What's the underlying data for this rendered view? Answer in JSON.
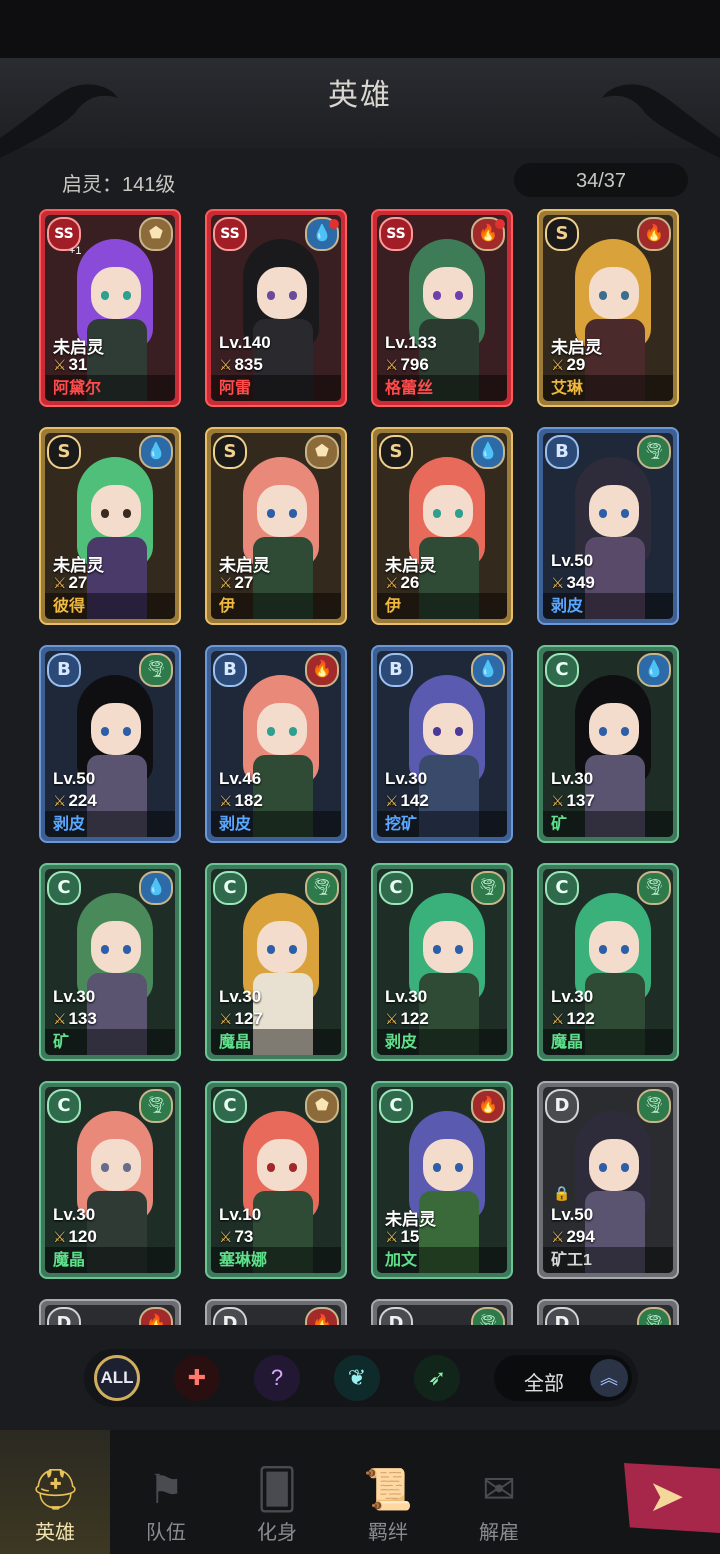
{
  "header": {
    "title": "英雄",
    "qiling": "启灵：141级",
    "count": "34/37"
  },
  "heroes": [
    {
      "rank": "SS",
      "elem": "earth",
      "elem_icon": "⬟",
      "level": "未启灵",
      "power": "31",
      "name": "阿黛尔",
      "name_color": "red",
      "plus": "+1",
      "hair": "#8a4cd8",
      "eye": "#2ea08f",
      "body": "#2f3b35",
      "dot": false
    },
    {
      "rank": "SS",
      "elem": "water",
      "elem_icon": "💧",
      "level": "Lv.140",
      "power": "835",
      "name": "阿雷",
      "name_color": "red",
      "hair": "#1a1a1d",
      "eye": "#6b4a9a",
      "body": "#2a2a2e",
      "dot": true
    },
    {
      "rank": "SS",
      "elem": "fire",
      "elem_icon": "🔥",
      "level": "Lv.133",
      "power": "796",
      "name": "格蕾丝",
      "name_color": "red",
      "hair": "#3e7c58",
      "eye": "#6f3fb0",
      "body": "#2c3b30",
      "dot": true
    },
    {
      "rank": "S",
      "elem": "fire",
      "elem_icon": "🔥",
      "level": "未启灵",
      "power": "29",
      "name": "艾琳",
      "name_color": "gold",
      "hair": "#d9a23a",
      "eye": "#3c6f8f",
      "body": "#4a2a2a",
      "dot": false
    },
    {
      "rank": "S",
      "elem": "water",
      "elem_icon": "💧",
      "level": "未启灵",
      "power": "27",
      "name": "彼得",
      "name_color": "gold",
      "hair": "#4fbf7a",
      "eye": "#3a2a22",
      "body": "#4a3a6a",
      "dot": false
    },
    {
      "rank": "S",
      "elem": "earth",
      "elem_icon": "⬟",
      "level": "未启灵",
      "power": "27",
      "name": "伊",
      "name_color": "gold",
      "hair": "#e8897a",
      "eye": "#2d5fa8",
      "body": "#2f4a35",
      "dot": false
    },
    {
      "rank": "S",
      "elem": "water",
      "elem_icon": "💧",
      "level": "未启灵",
      "power": "26",
      "name": "伊",
      "name_color": "gold",
      "hair": "#e86a5a",
      "eye": "#2ea08f",
      "body": "#2f4a35",
      "dot": false
    },
    {
      "rank": "B",
      "elem": "wind",
      "elem_icon": "🌪",
      "level": "Lv.50",
      "power": "349",
      "name": "剥皮",
      "name_color": "blue",
      "hair": "#2e2c3a",
      "eye": "#2d5fa8",
      "body": "#5a4a6a",
      "dot": false
    },
    {
      "rank": "B",
      "elem": "wind",
      "elem_icon": "🌪",
      "level": "Lv.50",
      "power": "224",
      "name": "剥皮",
      "name_color": "blue",
      "hair": "#0f0f12",
      "eye": "#2d5fa8",
      "body": "#5a5470",
      "dot": false
    },
    {
      "rank": "B",
      "elem": "fire",
      "elem_icon": "🔥",
      "level": "Lv.46",
      "power": "182",
      "name": "剥皮",
      "name_color": "blue",
      "hair": "#e8897a",
      "eye": "#2ea08f",
      "body": "#2f4a35",
      "dot": false
    },
    {
      "rank": "B",
      "elem": "water",
      "elem_icon": "💧",
      "level": "Lv.30",
      "power": "142",
      "name": "挖矿",
      "name_color": "blue",
      "hair": "#5a5ab0",
      "eye": "#4a3a9a",
      "body": "#3a4a6a",
      "dot": false
    },
    {
      "rank": "C",
      "elem": "water",
      "elem_icon": "💧",
      "level": "Lv.30",
      "power": "137",
      "name": "矿",
      "name_color": "green",
      "hair": "#0f0f12",
      "eye": "#2d5fa8",
      "body": "#5a5470",
      "dot": false
    },
    {
      "rank": "C",
      "elem": "water",
      "elem_icon": "💧",
      "level": "Lv.30",
      "power": "133",
      "name": "矿",
      "name_color": "green",
      "hair": "#4a8a5a",
      "eye": "#2d5fa8",
      "body": "#5a5470",
      "dot": false
    },
    {
      "rank": "C",
      "elem": "wind",
      "elem_icon": "🌪",
      "level": "Lv.30",
      "power": "127",
      "name": "魔晶",
      "name_color": "green",
      "hair": "#d9a23a",
      "eye": "#2d5fa8",
      "body": "#e8e0d0",
      "dot": false
    },
    {
      "rank": "C",
      "elem": "wind",
      "elem_icon": "🌪",
      "level": "Lv.30",
      "power": "122",
      "name": "剥皮",
      "name_color": "green",
      "hair": "#3ab07a",
      "eye": "#2d5fa8",
      "body": "#2f4a35",
      "dot": false
    },
    {
      "rank": "C",
      "elem": "wind",
      "elem_icon": "🌪",
      "level": "Lv.30",
      "power": "122",
      "name": "魔晶",
      "name_color": "green",
      "hair": "#3ab07a",
      "eye": "#2d5fa8",
      "body": "#2f4a35",
      "dot": false
    },
    {
      "rank": "C",
      "elem": "wind",
      "elem_icon": "🌪",
      "level": "Lv.30",
      "power": "120",
      "name": "魔晶",
      "name_color": "green",
      "hair": "#e8897a",
      "eye": "#6a6a8a",
      "body": "#2f3a35",
      "dot": false
    },
    {
      "rank": "C",
      "elem": "earth",
      "elem_icon": "⬟",
      "level": "Lv.10",
      "power": "73",
      "name": "塞琳娜",
      "name_color": "green",
      "hair": "#e86a5a",
      "eye": "#a02a2a",
      "body": "#2f4a35",
      "dot": false
    },
    {
      "rank": "C",
      "elem": "fire",
      "elem_icon": "🔥",
      "level": "未启灵",
      "power": "15",
      "name": "加文",
      "name_color": "green",
      "hair": "#5a5ab0",
      "eye": "#2d5fa8",
      "body": "#3a6a3a",
      "dot": false
    },
    {
      "rank": "D",
      "elem": "wind",
      "elem_icon": "🌪",
      "level": "Lv.50",
      "power": "294",
      "name": "矿工1",
      "name_color": "grey",
      "hair": "#2e2c3a",
      "eye": "#2d5fa8",
      "body": "#5a5470",
      "dot": false,
      "locked": true
    },
    {
      "rank": "D",
      "elem": "fire",
      "elem_icon": "🔥",
      "level": "",
      "power": "",
      "name": "",
      "name_color": "grey",
      "hair": "#e86a5a",
      "eye": "#2d5fa8",
      "body": "#333",
      "dot": false
    },
    {
      "rank": "D",
      "elem": "fire",
      "elem_icon": "🔥",
      "level": "",
      "power": "",
      "name": "",
      "name_color": "grey",
      "hair": "#ddd",
      "eye": "#2d5fa8",
      "body": "#333",
      "dot": false
    },
    {
      "rank": "D",
      "elem": "wind",
      "elem_icon": "🌪",
      "level": "",
      "power": "",
      "name": "",
      "name_color": "grey",
      "hair": "#4a4a3a",
      "eye": "#2d5fa8",
      "body": "#333",
      "dot": false
    },
    {
      "rank": "D",
      "elem": "wind",
      "elem_icon": "🌪",
      "level": "",
      "power": "",
      "name": "",
      "name_color": "grey",
      "hair": "#4a4a3a",
      "eye": "#2d5fa8",
      "body": "#333",
      "dot": false
    }
  ],
  "filters": {
    "all": "ALL",
    "scope": "全部"
  },
  "tabs": [
    {
      "label": "英雄",
      "icon": "helmet-icon",
      "glyph": "⛑",
      "active": true
    },
    {
      "label": "队伍",
      "icon": "flag-icon",
      "glyph": "⚑",
      "active": false
    },
    {
      "label": "化身",
      "icon": "cards-icon",
      "glyph": "🂠",
      "active": false
    },
    {
      "label": "羁绊",
      "icon": "book-icon",
      "glyph": "📜",
      "active": false
    },
    {
      "label": "解雇",
      "icon": "scroll-icon",
      "glyph": "✉",
      "active": false
    }
  ]
}
